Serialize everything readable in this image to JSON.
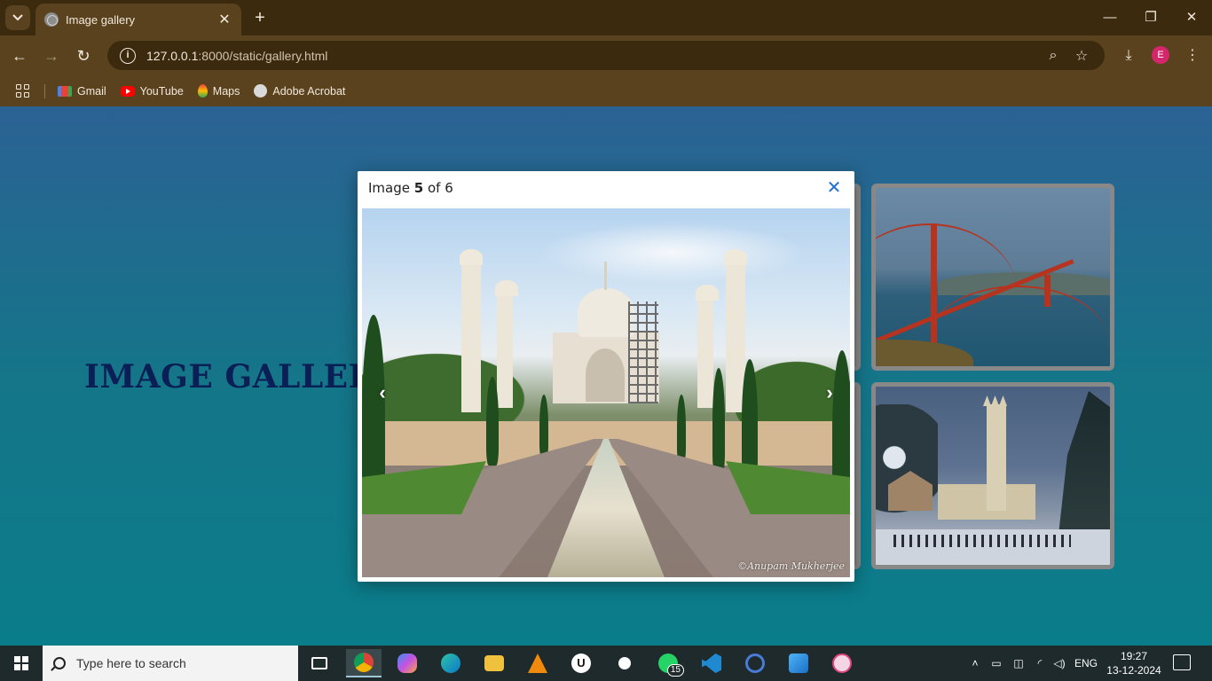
{
  "browser": {
    "tab_title": "Image gallery",
    "tab_close": "✕",
    "new_tab": "+",
    "url_host": "127.0.0.1",
    "url_rest": ":8000/static/gallery.html",
    "avatar_letter": "E",
    "bookmarks": [
      {
        "label": "Gmail",
        "icon": "gmail-icon"
      },
      {
        "label": "YouTube",
        "icon": "youtube-icon"
      },
      {
        "label": "Maps",
        "icon": "maps-icon"
      },
      {
        "label": "Adobe Acrobat",
        "icon": "acrobat-icon"
      }
    ]
  },
  "page": {
    "title": "IMAGE GALLERY",
    "thumbnails": [
      {
        "subject": "Golden Gate Bridge",
        "icon": "bridge-photo"
      },
      {
        "subject": "Church in snow",
        "icon": "church-photo"
      }
    ]
  },
  "lightbox": {
    "caption_prefix": "Image",
    "current": "5",
    "caption_mid": "of",
    "total": "6",
    "close_glyph": "✕",
    "prev_glyph": "‹",
    "next_glyph": "›",
    "image_credit": "©Anupam Mukherjee"
  },
  "taskbar": {
    "search_placeholder": "Type here to search",
    "whatsapp_badge": "15",
    "language": "ENG",
    "time": "19:27",
    "date": "13-12-2024"
  },
  "colors": {
    "title": "#0a1f55",
    "close_accent": "#1d6fd6",
    "chrome_bg": "#5b421e"
  }
}
